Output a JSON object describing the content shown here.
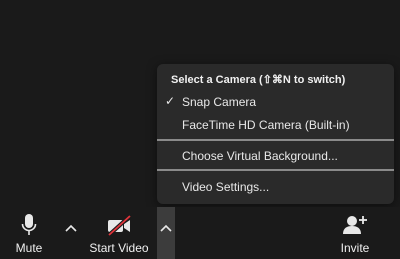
{
  "camera_menu": {
    "header": "Select a Camera (⇧⌘N to switch)",
    "items": [
      {
        "label": "Snap Camera",
        "checked": true
      },
      {
        "label": "FaceTime HD Camera (Built-in)",
        "checked": false
      }
    ],
    "check_mark": "✓",
    "virtual_background": "Choose Virtual Background...",
    "video_settings": "Video Settings..."
  },
  "toolbar": {
    "mute_label": "Mute",
    "start_video_label": "Start Video",
    "invite_label": "Invite"
  },
  "icons": {
    "mute": "microphone-icon",
    "start_video": "video-camera-off-icon",
    "invite": "add-person-icon",
    "caret": "chevron-up-icon"
  },
  "colors": {
    "background": "#1a1a1a",
    "menu_background": "#2a2a2a",
    "strike": "#e0343b"
  }
}
